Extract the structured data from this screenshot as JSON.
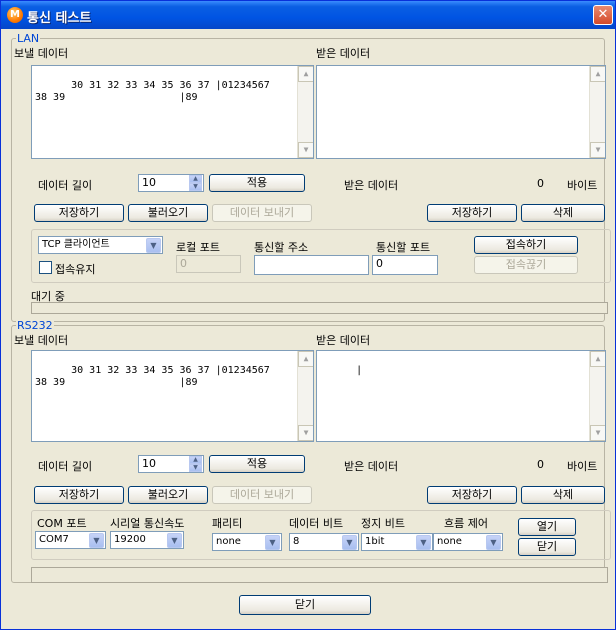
{
  "window": {
    "title": "통신 테스트",
    "icon": "app-m-icon",
    "close_glyph": "✕"
  },
  "lan": {
    "legend": "LAN",
    "send_label": "보낼 데이터",
    "recv_label": "받은 데이터",
    "send_lines": "30 31 32 33 34 35 36 37 |01234567\n38 39                   |89",
    "recv_text": "",
    "length_label": "데이터 길이",
    "length_value": "10",
    "apply_button": "적용",
    "recv_count_label": "받은 데이터",
    "recv_count": "0",
    "bytes_label": "바이트",
    "save_button": "저장하기",
    "load_button": "불러오기",
    "send_button": "데이터 보내기",
    "recv_save_button": "저장하기",
    "delete_button": "삭제",
    "mode_value": "TCP 클라이언트",
    "keep_conn_label": "접속유지",
    "local_port_label": "로컬 포트",
    "local_port_value": "0",
    "remote_addr_label": "통신할 주소",
    "remote_addr_value": "",
    "remote_port_label": "통신할 포트",
    "remote_port_value": "0",
    "connect_button": "접속하기",
    "disconnect_button": "접속끊기",
    "status": "대기 중"
  },
  "rs232": {
    "legend": "RS232",
    "send_label": "보낼 데이터",
    "recv_label": "받은 데이터",
    "send_lines": "30 31 32 33 34 35 36 37 |01234567\n38 39                   |89",
    "recv_text": "|",
    "length_label": "데이터 길이",
    "length_value": "10",
    "apply_button": "적용",
    "recv_count_label": "받은 데이터",
    "recv_count": "0",
    "bytes_label": "바이트",
    "save_button": "저장하기",
    "load_button": "불러오기",
    "send_button": "데이터 보내기",
    "recv_save_button": "저장하기",
    "delete_button": "삭제",
    "port_label": "COM 포트",
    "port_value": "COM7",
    "baud_label": "시리얼 통신속도",
    "baud_value": "19200",
    "parity_label": "패리티",
    "parity_value": "none",
    "databits_label": "데이터 비트",
    "databits_value": "8",
    "stopbits_label": "정지 비트",
    "stopbits_value": "1bit",
    "flow_label": "흐름 제어",
    "flow_value": "none",
    "open_button": "열기",
    "close_port_button": "닫기",
    "status": ""
  },
  "footer": {
    "close_button": "닫기"
  },
  "colors": {
    "titlebar": "#0054e3",
    "legend": "#0046d5",
    "face": "#ece9d8"
  }
}
